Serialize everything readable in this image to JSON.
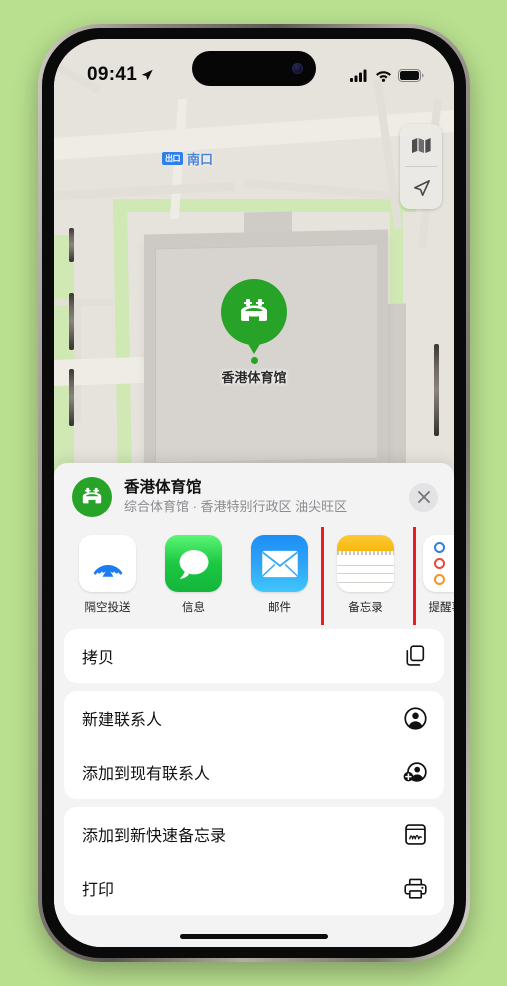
{
  "background_color": "#b9e08f",
  "status_bar": {
    "time": "09:41",
    "location_arrow": "location-arrow-icon",
    "cellular": "cellular-bars-icon",
    "wifi": "wifi-icon",
    "battery": "battery-icon"
  },
  "map": {
    "transit_badge": "出口",
    "transit_label": "南口",
    "pin_label": "香港体育馆",
    "controls": [
      {
        "name": "map-layers-button",
        "icon": "map-icon"
      },
      {
        "name": "locate-me-button",
        "icon": "navigation-arrow-icon"
      }
    ]
  },
  "share_sheet": {
    "place_title": "香港体育馆",
    "place_subtitle": "综合体育馆 · 香港特别行政区 油尖旺区",
    "place_icon": "stadium-icon",
    "close_label": "✕",
    "apps": [
      {
        "label": "隔空投送",
        "icon": "airdrop-icon",
        "highlighted": false
      },
      {
        "label": "信息",
        "icon": "messages-icon",
        "highlighted": false
      },
      {
        "label": "邮件",
        "icon": "mail-icon",
        "highlighted": false
      },
      {
        "label": "备忘录",
        "icon": "notes-icon",
        "highlighted": true
      },
      {
        "label": "提醒事项",
        "icon": "reminders-icon",
        "highlighted": false
      }
    ],
    "actions": [
      {
        "label": "拷贝",
        "icon": "copy-icon"
      },
      {
        "label": "新建联系人",
        "icon": "person-circle-icon"
      },
      {
        "label": "添加到现有联系人",
        "icon": "person-add-icon"
      },
      {
        "label": "添加到新快速备忘录",
        "icon": "quick-note-icon"
      },
      {
        "label": "打印",
        "icon": "printer-icon"
      }
    ],
    "highlight_color": "#ed1c24"
  }
}
